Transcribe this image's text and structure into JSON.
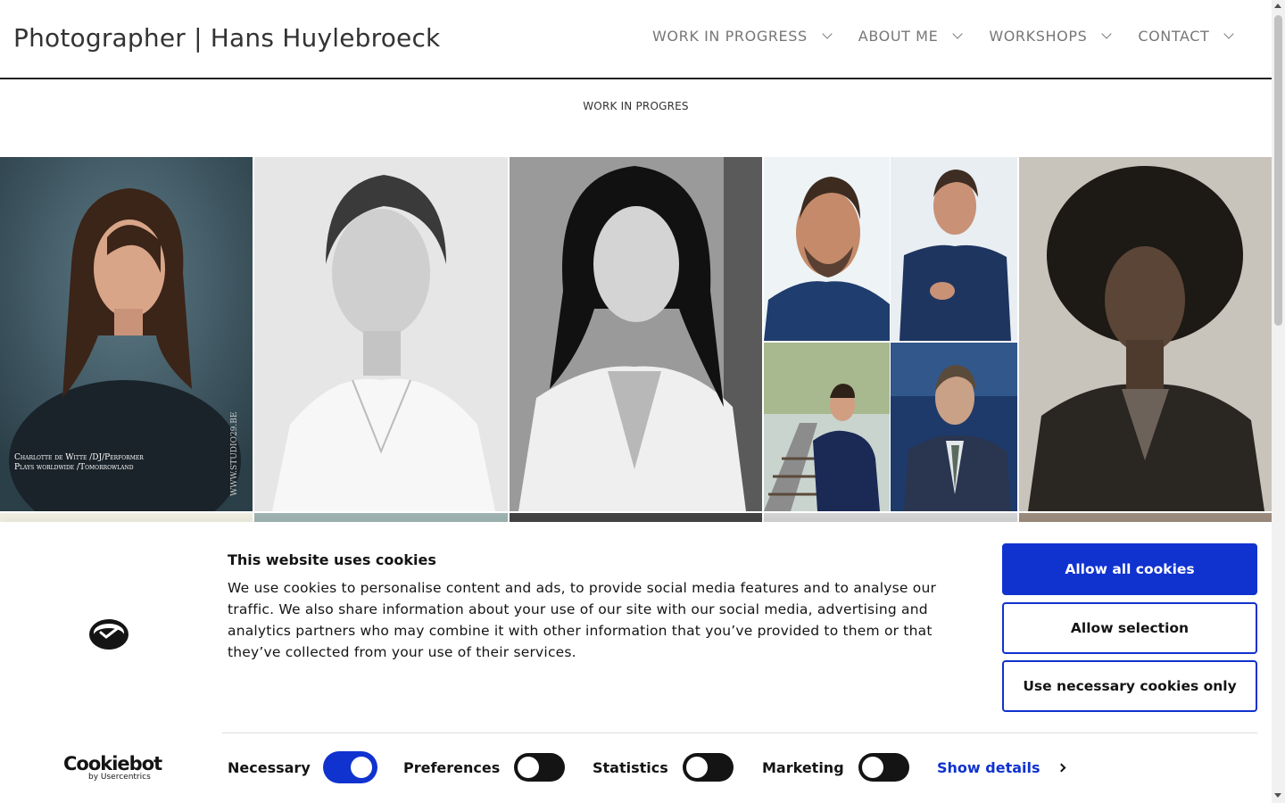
{
  "header": {
    "site_title": "Photographer | Hans Huylebroeck",
    "nav": [
      {
        "label": "WORK IN PROGRESS",
        "icon": "chevron-down-icon"
      },
      {
        "label": "ABOUT ME",
        "icon": "chevron-down-icon"
      },
      {
        "label": "WORKSHOPS",
        "icon": "chevron-down-icon"
      },
      {
        "label": "CONTACT",
        "icon": "chevron-down-icon"
      }
    ]
  },
  "page": {
    "subtitle": "WORK IN PROGRES"
  },
  "gallery": {
    "tiles": [
      {
        "name": "portrait-charlotte",
        "caption_line1": "Charlotte de Witte /DJ/Performer",
        "caption_line2": "Plays worldwide /Tomorrowland",
        "watermark": "WWW.STUDIO29.BE"
      },
      {
        "name": "portrait-white-shirt"
      },
      {
        "name": "portrait-white-blouse"
      },
      {
        "name": "portrait-man-beard"
      },
      {
        "name": "portrait-man-smile"
      },
      {
        "name": "portrait-man-tracks"
      },
      {
        "name": "portrait-man-window"
      },
      {
        "name": "portrait-curly-hair"
      }
    ]
  },
  "cookie_banner": {
    "title": "This website uses cookies",
    "text": "We use cookies to personalise content and ads, to provide social media features and to analyse our traffic. We also share information about your use of our site with our social media, advertising and analytics partners who may combine it with other information that you’ve provided to them or that they’ve collected from your use of their services.",
    "buttons": {
      "allow_all": "Allow all cookies",
      "allow_selection": "Allow selection",
      "necessary_only": "Use necessary cookies only"
    },
    "toggles": [
      {
        "label": "Necessary",
        "state": "on"
      },
      {
        "label": "Preferences",
        "state": "off"
      },
      {
        "label": "Statistics",
        "state": "off"
      },
      {
        "label": "Marketing",
        "state": "off"
      }
    ],
    "show_details": "Show details",
    "brand": {
      "name": "Cookiebot",
      "by": "by Usercentrics"
    },
    "colors": {
      "accent": "#1032cf",
      "text": "#141414"
    }
  }
}
